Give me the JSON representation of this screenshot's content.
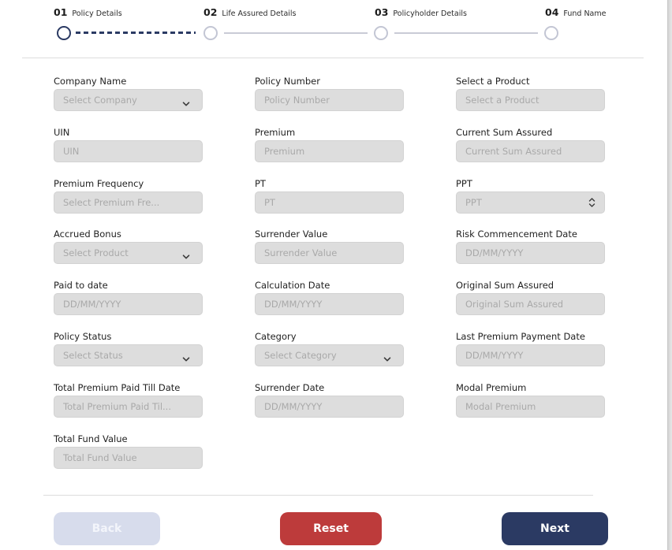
{
  "stepper": {
    "steps": [
      {
        "num": "01",
        "label": "Policy Details",
        "state": "active"
      },
      {
        "num": "02",
        "label": "Life Assured Details",
        "state": "pending"
      },
      {
        "num": "03",
        "label": "Policyholder Details",
        "state": "pending"
      },
      {
        "num": "04",
        "label": "Fund Name",
        "state": "pending"
      }
    ]
  },
  "form": {
    "fields": [
      {
        "label": "Company Name",
        "placeholder": "Select Company",
        "type": "select"
      },
      {
        "label": "Policy Number",
        "placeholder": "Policy Number",
        "type": "text"
      },
      {
        "label": "Select a Product",
        "placeholder": "Select a Product",
        "type": "text"
      },
      {
        "label": "UIN",
        "placeholder": "UIN",
        "type": "text"
      },
      {
        "label": "Premium",
        "placeholder": "Premium",
        "type": "text"
      },
      {
        "label": "Current Sum Assured",
        "placeholder": "Current Sum Assured",
        "type": "text"
      },
      {
        "label": "Premium Frequency",
        "placeholder": "Select Premium Fre...",
        "type": "text"
      },
      {
        "label": "PT",
        "placeholder": "PT",
        "type": "text"
      },
      {
        "label": "PPT",
        "placeholder": "PPT",
        "type": "number"
      },
      {
        "label": "Accrued Bonus",
        "placeholder": "Select Product",
        "type": "select"
      },
      {
        "label": "Surrender Value",
        "placeholder": "Surrender Value",
        "type": "text"
      },
      {
        "label": "Risk Commencement Date",
        "placeholder": "DD/MM/YYYY",
        "type": "date"
      },
      {
        "label": "Paid to date",
        "placeholder": "DD/MM/YYYY",
        "type": "date"
      },
      {
        "label": "Calculation Date",
        "placeholder": "DD/MM/YYYY",
        "type": "date"
      },
      {
        "label": "Original Sum Assured",
        "placeholder": "Original Sum Assured",
        "type": "text"
      },
      {
        "label": "Policy Status",
        "placeholder": "Select Status",
        "type": "select"
      },
      {
        "label": "Category",
        "placeholder": "Select Category",
        "type": "select"
      },
      {
        "label": "Last Premium Payment Date",
        "placeholder": "DD/MM/YYYY",
        "type": "date"
      },
      {
        "label": "Total Premium Paid Till Date",
        "placeholder": "Total Premium Paid Til...",
        "type": "text"
      },
      {
        "label": "Surrender Date",
        "placeholder": "DD/MM/YYYY",
        "type": "date"
      },
      {
        "label": "Modal Premium",
        "placeholder": "Modal Premium",
        "type": "text"
      },
      {
        "label": "Total Fund Value",
        "placeholder": "Total Fund Value",
        "type": "text"
      }
    ]
  },
  "actions": {
    "back_label": "Back",
    "reset_label": "Reset",
    "next_label": "Next"
  },
  "colors": {
    "primary": "#2b3a63",
    "danger": "#bd3b3b",
    "disabled": "#d7dcec",
    "input_bg": "#dddddd"
  }
}
